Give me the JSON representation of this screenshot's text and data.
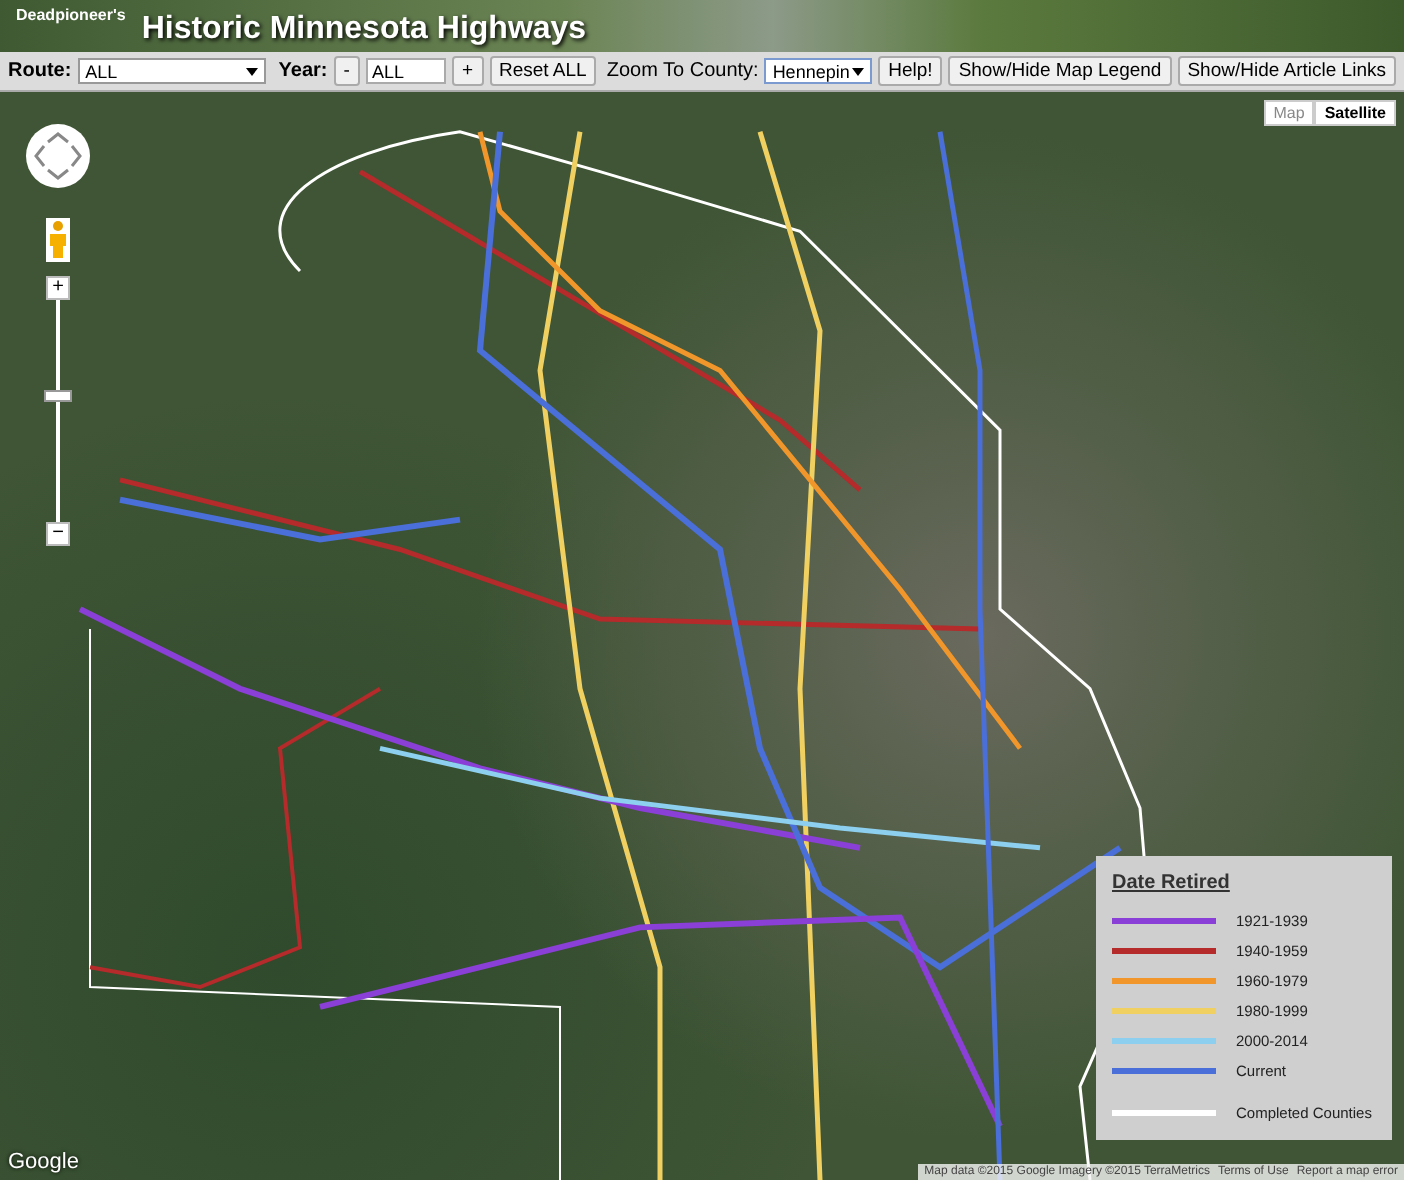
{
  "header": {
    "subtitle": "Deadpioneer's",
    "title": "Historic Minnesota Highways"
  },
  "toolbar": {
    "route_label": "Route:",
    "route_value": "ALL",
    "year_label": "Year:",
    "year_minus": "-",
    "year_value": "ALL",
    "year_plus": "+",
    "reset": "Reset ALL",
    "county_label": "Zoom To County:",
    "county_value": "Hennepin",
    "help": "Help!",
    "legend_toggle": "Show/Hide Map Legend",
    "links_toggle": "Show/Hide Article Links"
  },
  "map": {
    "map_types": [
      {
        "label": "Map",
        "selected": false
      },
      {
        "label": "Satellite",
        "selected": true
      }
    ],
    "zoom_in": "+",
    "zoom_out": "−",
    "legend": {
      "title": "Date Retired",
      "items": [
        {
          "label": "1921-1939",
          "color": "#8a3fd6"
        },
        {
          "label": "1940-1959",
          "color": "#b52a2a"
        },
        {
          "label": "1960-1979",
          "color": "#f0962a"
        },
        {
          "label": "1980-1999",
          "color": "#f0d060"
        },
        {
          "label": "2000-2014",
          "color": "#8ccfee"
        },
        {
          "label": "Current",
          "color": "#4a6fd8"
        },
        {
          "label": "Completed Counties",
          "color": "#ffffff"
        }
      ]
    },
    "logo": "Google",
    "attribution": "Map data ©2015 Google Imagery ©2015 TerraMetrics",
    "terms": "Terms of Use",
    "report": "Report a map error"
  }
}
